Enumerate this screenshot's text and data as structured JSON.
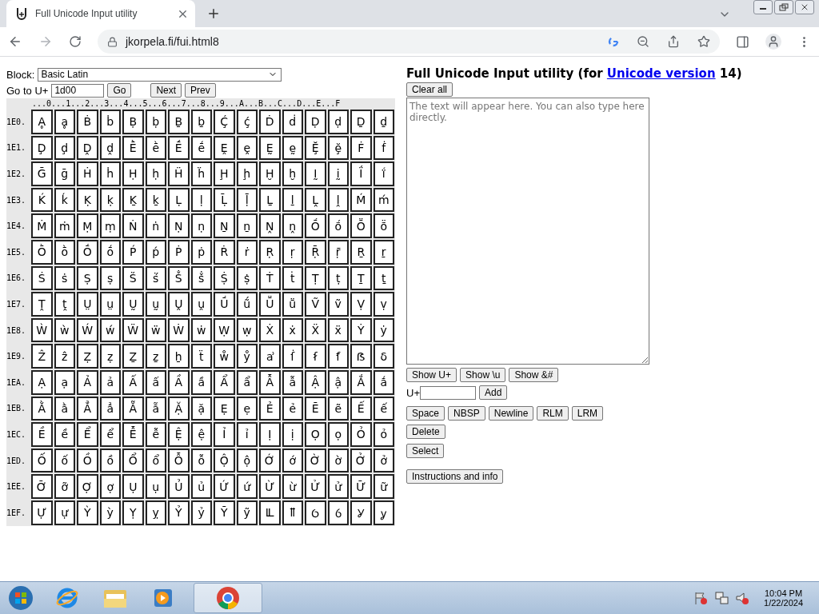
{
  "browser": {
    "tab": {
      "title": "Full Unicode Input utility",
      "selected": true
    },
    "address": "jkorpela.fi/fui.html8"
  },
  "controls": {
    "block_label": "Block:",
    "block_value": "Basic Latin",
    "goto_label": "Go to U+",
    "goto_value": "1d00",
    "buttons": [
      "Go",
      "Next",
      "Prev"
    ]
  },
  "grid": {
    "header": "...0...1...2...3...4...5...6...7...8...9...A...B...C...D...E...F",
    "rows": [
      {
        "label": "1E0.",
        "cells": [
          "Ḁ",
          "ḁ",
          "Ḃ",
          "ḃ",
          "Ḅ",
          "ḅ",
          "Ḇ",
          "ḇ",
          "Ḉ",
          "ḉ",
          "Ḋ",
          "ḋ",
          "Ḍ",
          "ḍ",
          "Ḏ",
          "ḏ"
        ]
      },
      {
        "label": "1E1.",
        "cells": [
          "Ḑ",
          "ḑ",
          "Ḓ",
          "ḓ",
          "Ḕ",
          "ḕ",
          "Ḗ",
          "ḗ",
          "Ḙ",
          "ḙ",
          "Ḛ",
          "ḛ",
          "Ḝ",
          "ḝ",
          "Ḟ",
          "ḟ"
        ]
      },
      {
        "label": "1E2.",
        "cells": [
          "Ḡ",
          "ḡ",
          "Ḣ",
          "ḣ",
          "Ḥ",
          "ḥ",
          "Ḧ",
          "ḧ",
          "Ḩ",
          "ḩ",
          "Ḫ",
          "ḫ",
          "Ḭ",
          "ḭ",
          "Ḯ",
          "ḯ"
        ]
      },
      {
        "label": "1E3.",
        "cells": [
          "Ḱ",
          "ḱ",
          "Ḳ",
          "ḳ",
          "Ḵ",
          "ḵ",
          "Ḷ",
          "ḷ",
          "Ḹ",
          "ḹ",
          "Ḻ",
          "ḻ",
          "Ḽ",
          "ḽ",
          "Ḿ",
          "ḿ"
        ]
      },
      {
        "label": "1E4.",
        "cells": [
          "Ṁ",
          "ṁ",
          "Ṃ",
          "ṃ",
          "Ṅ",
          "ṅ",
          "Ṇ",
          "ṇ",
          "Ṉ",
          "ṉ",
          "Ṋ",
          "ṋ",
          "Ṍ",
          "ṍ",
          "Ṏ",
          "ṏ"
        ]
      },
      {
        "label": "1E5.",
        "cells": [
          "Ṑ",
          "ṑ",
          "Ṓ",
          "ṓ",
          "Ṕ",
          "ṕ",
          "Ṗ",
          "ṗ",
          "Ṙ",
          "ṙ",
          "Ṛ",
          "ṛ",
          "Ṝ",
          "ṝ",
          "Ṟ",
          "ṟ"
        ]
      },
      {
        "label": "1E6.",
        "cells": [
          "Ṡ",
          "ṡ",
          "Ṣ",
          "ṣ",
          "Ṥ",
          "ṥ",
          "Ṧ",
          "ṧ",
          "Ṩ",
          "ṩ",
          "Ṫ",
          "ṫ",
          "Ṭ",
          "ṭ",
          "Ṯ",
          "ṯ"
        ]
      },
      {
        "label": "1E7.",
        "cells": [
          "Ṱ",
          "ṱ",
          "Ṳ",
          "ṳ",
          "Ṵ",
          "ṵ",
          "Ṷ",
          "ṷ",
          "Ṹ",
          "ṹ",
          "Ṻ",
          "ṻ",
          "Ṽ",
          "ṽ",
          "Ṿ",
          "ṿ"
        ]
      },
      {
        "label": "1E8.",
        "cells": [
          "Ẁ",
          "ẁ",
          "Ẃ",
          "ẃ",
          "Ẅ",
          "ẅ",
          "Ẇ",
          "ẇ",
          "Ẉ",
          "ẉ",
          "Ẋ",
          "ẋ",
          "Ẍ",
          "ẍ",
          "Ẏ",
          "ẏ"
        ]
      },
      {
        "label": "1E9.",
        "cells": [
          "Ẑ",
          "ẑ",
          "Ẓ",
          "ẓ",
          "Ẕ",
          "ẕ",
          "ẖ",
          "ẗ",
          "ẘ",
          "ẙ",
          "ẚ",
          "ẛ",
          "ẜ",
          "ẝ",
          "ẞ",
          "ẟ"
        ]
      },
      {
        "label": "1EA.",
        "cells": [
          "Ạ",
          "ạ",
          "Ả",
          "ả",
          "Ấ",
          "ấ",
          "Ầ",
          "ầ",
          "Ẩ",
          "ẩ",
          "Ẫ",
          "ẫ",
          "Ậ",
          "ậ",
          "Ắ",
          "ắ"
        ]
      },
      {
        "label": "1EB.",
        "cells": [
          "Ằ",
          "ằ",
          "Ẳ",
          "ẳ",
          "Ẵ",
          "ẵ",
          "Ặ",
          "ặ",
          "Ẹ",
          "ẹ",
          "Ẻ",
          "ẻ",
          "Ẽ",
          "ẽ",
          "Ế",
          "ế"
        ]
      },
      {
        "label": "1EC.",
        "cells": [
          "Ề",
          "ề",
          "Ể",
          "ể",
          "Ễ",
          "ễ",
          "Ệ",
          "ệ",
          "Ỉ",
          "ỉ",
          "Ị",
          "ị",
          "Ọ",
          "ọ",
          "Ỏ",
          "ỏ"
        ]
      },
      {
        "label": "1ED.",
        "cells": [
          "Ố",
          "ố",
          "Ồ",
          "ồ",
          "Ổ",
          "ổ",
          "Ỗ",
          "ỗ",
          "Ộ",
          "ộ",
          "Ớ",
          "ớ",
          "Ờ",
          "ờ",
          "Ở",
          "ở"
        ]
      },
      {
        "label": "1EE.",
        "cells": [
          "Ỡ",
          "ỡ",
          "Ợ",
          "ợ",
          "Ụ",
          "ụ",
          "Ủ",
          "ủ",
          "Ứ",
          "ứ",
          "Ừ",
          "ừ",
          "Ử",
          "ử",
          "Ữ",
          "ữ"
        ]
      },
      {
        "label": "1EF.",
        "cells": [
          "Ự",
          "ự",
          "Ỳ",
          "ỳ",
          "Ỵ",
          "ỵ",
          "Ỷ",
          "ỷ",
          "Ỹ",
          "ỹ",
          "Ỻ",
          "ỻ",
          "Ỽ",
          "ỽ",
          "Ỿ",
          "ỿ"
        ]
      }
    ]
  },
  "editor": {
    "heading_start": "Full Unicode Input utility (for",
    "heading_link": "Unicode version",
    "heading_end": "14)",
    "clear_button": "Clear all",
    "placeholder": "The text will appear here. You can also type here directly.",
    "show_buttons": [
      "Show U+",
      "Show \\u",
      "Show &#"
    ],
    "add_label": "U+",
    "add_button": "Add",
    "insert_buttons": [
      "Space",
      "NBSP",
      "Newline",
      "RLM",
      "LRM"
    ],
    "delete_button": "Delete",
    "select_button": "Select",
    "info_button": "Instructions and info"
  },
  "taskbar": {
    "time": "10:04 PM",
    "date": "1/22/2024"
  }
}
